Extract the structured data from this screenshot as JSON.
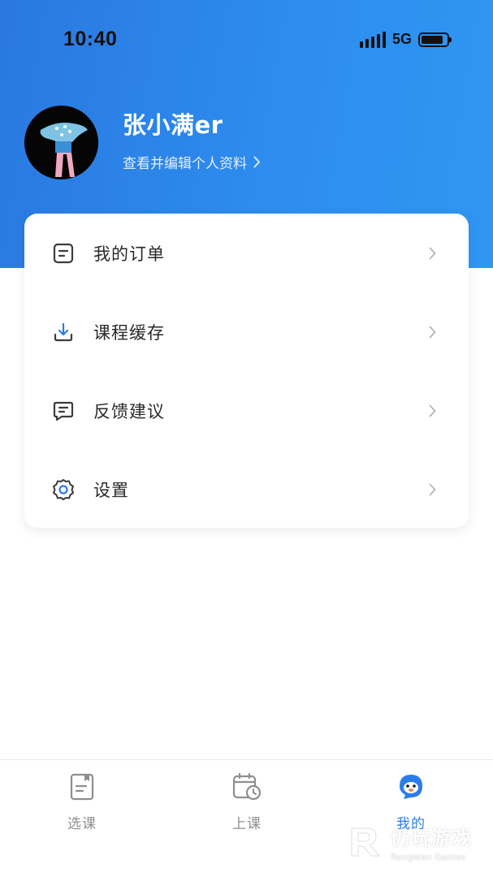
{
  "status_bar": {
    "time": "10:40",
    "network": "5G"
  },
  "colors": {
    "header_gradient_start": "#2a78df",
    "header_gradient_end": "#2f96f2",
    "active_tab": "#2b7de9",
    "inactive_tab": "#8e8e8e"
  },
  "profile": {
    "username": "张小满er",
    "edit_link": "查看并编辑个人资料"
  },
  "menu": {
    "items": [
      {
        "label": "我的订单",
        "icon": "order-icon"
      },
      {
        "label": "课程缓存",
        "icon": "download-icon"
      },
      {
        "label": "反馈建议",
        "icon": "feedback-icon"
      },
      {
        "label": "设置",
        "icon": "gear-icon"
      }
    ]
  },
  "tabbar": {
    "tabs": [
      {
        "label": "选课",
        "icon": "course-book-icon",
        "active": false
      },
      {
        "label": "上课",
        "icon": "calendar-clock-icon",
        "active": false
      },
      {
        "label": "我的",
        "icon": "mascot-icon",
        "active": true
      }
    ]
  },
  "watermark": {
    "title": "仍玩游戏",
    "subtitle": "Rengwan Games"
  }
}
